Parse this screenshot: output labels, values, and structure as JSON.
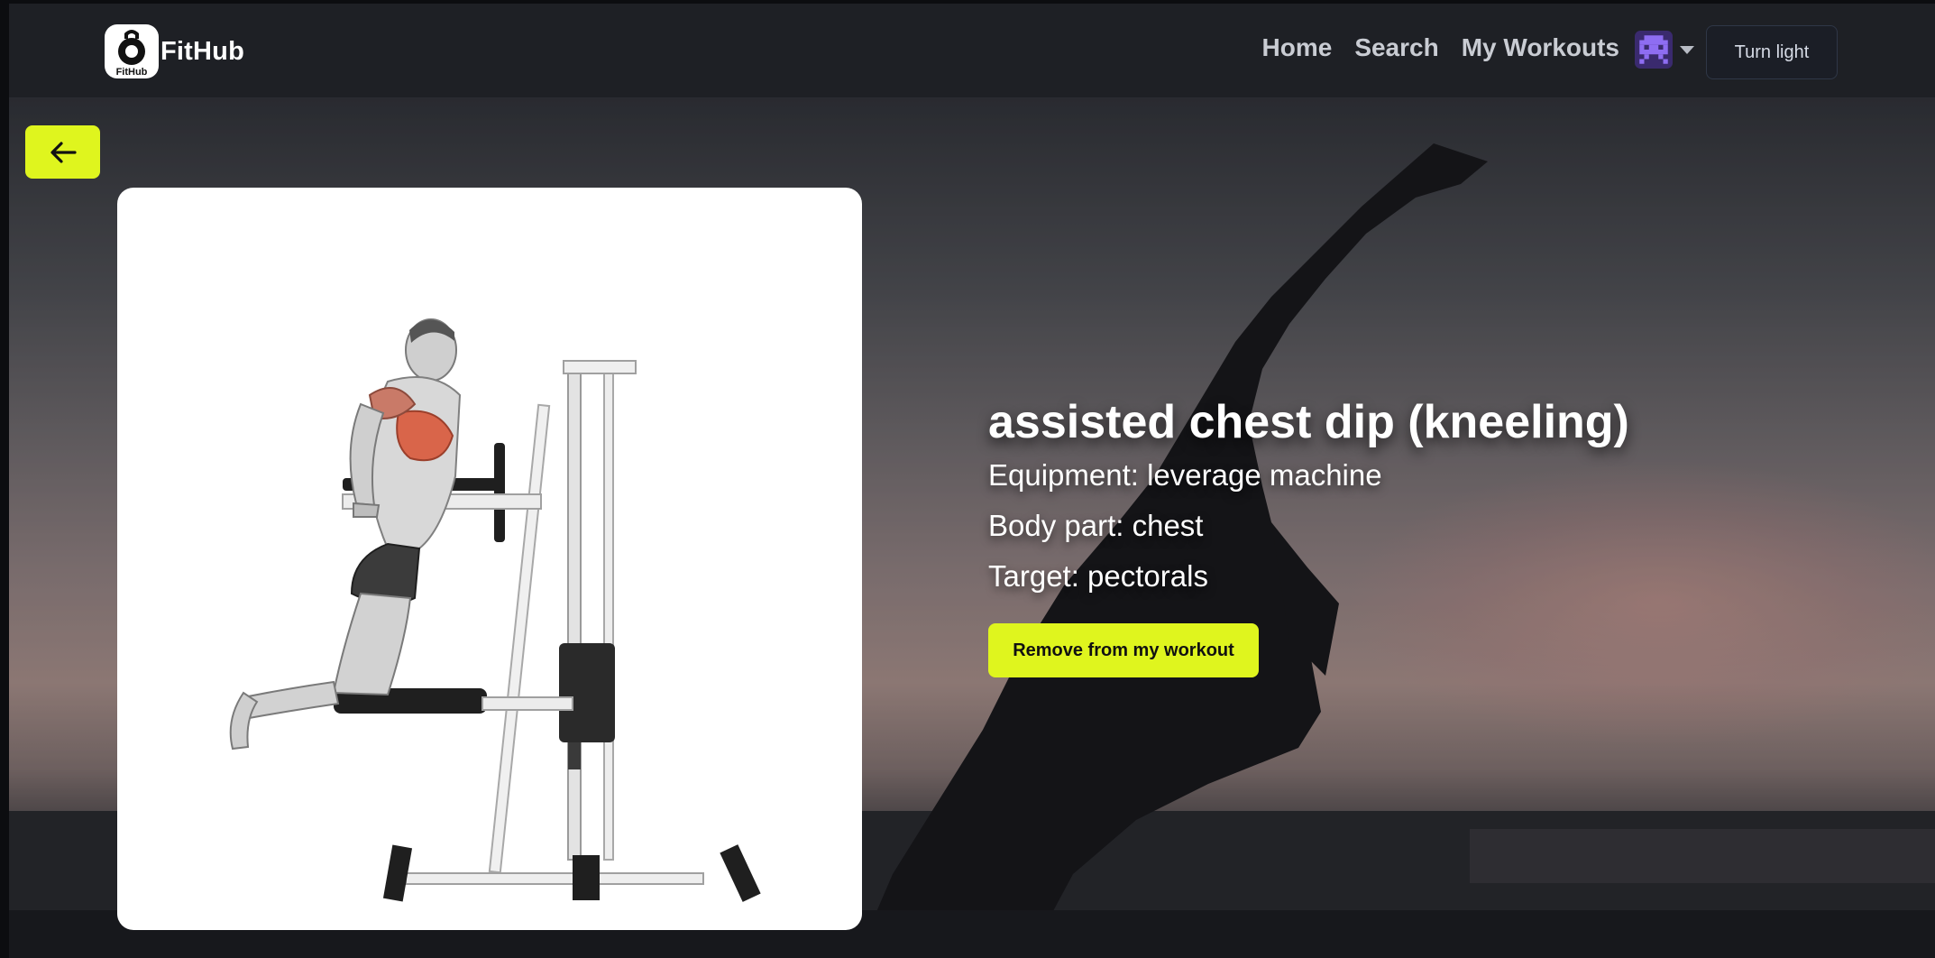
{
  "navbar": {
    "brand_name": "FitHub",
    "brand_logo_text": "FitHub",
    "links": [
      "Home",
      "Search",
      "My Workouts"
    ],
    "avatar_icon": "pixel-invader-avatar-icon",
    "theme_button": "Turn light"
  },
  "back_button": {
    "icon": "arrow-left-icon"
  },
  "exercise": {
    "name": "assisted chest dip (kneeling)",
    "equipment": "Equipment: leverage machine",
    "body_part": "Body part: chest",
    "target": "Target: pectorals",
    "action_button": "Remove from my workout",
    "image_icon": "exercise-illustration"
  },
  "colors": {
    "accent": "#dff51e",
    "navbar_bg": "#1e2025",
    "text_light": "#ffffff",
    "nav_link": "#c9ccd3"
  }
}
